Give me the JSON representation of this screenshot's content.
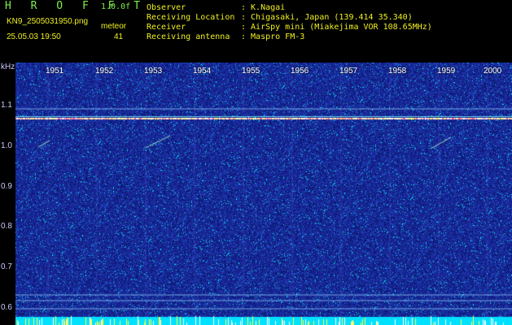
{
  "header": {
    "title": "H R O F F T",
    "version": "1.0.0f",
    "filename": "KN9_2505031950.png",
    "datetime": "25.05.03 19:50",
    "meteor_label": "meteor",
    "meteor_count": "41",
    "fields": [
      {
        "label": "Observer",
        "value": ": K.Nagai"
      },
      {
        "label": "Receiving Location",
        "value": ": Chigasaki, Japan (139.414 35.340)"
      },
      {
        "label": "Receiver",
        "value": ": AirSpy mini (Miakejima VOR 108.65MHz)"
      },
      {
        "label": "Receiving antenna",
        "value": ": Maspro FM-3"
      }
    ]
  },
  "axis": {
    "unit": "kHz",
    "y_ticks": [
      "1.1",
      "1.0",
      "0.9",
      "0.8",
      "0.7",
      "0.6"
    ],
    "x_ticks": [
      "1951",
      "1952",
      "1953",
      "1954",
      "1955",
      "1956",
      "1957",
      "1958",
      "1959",
      "2000"
    ]
  },
  "colors": {
    "background": "#1a2a9c",
    "noise_bright": "#00ffff",
    "carrier": "#ffffff",
    "baseline": "#00e0ff"
  }
}
